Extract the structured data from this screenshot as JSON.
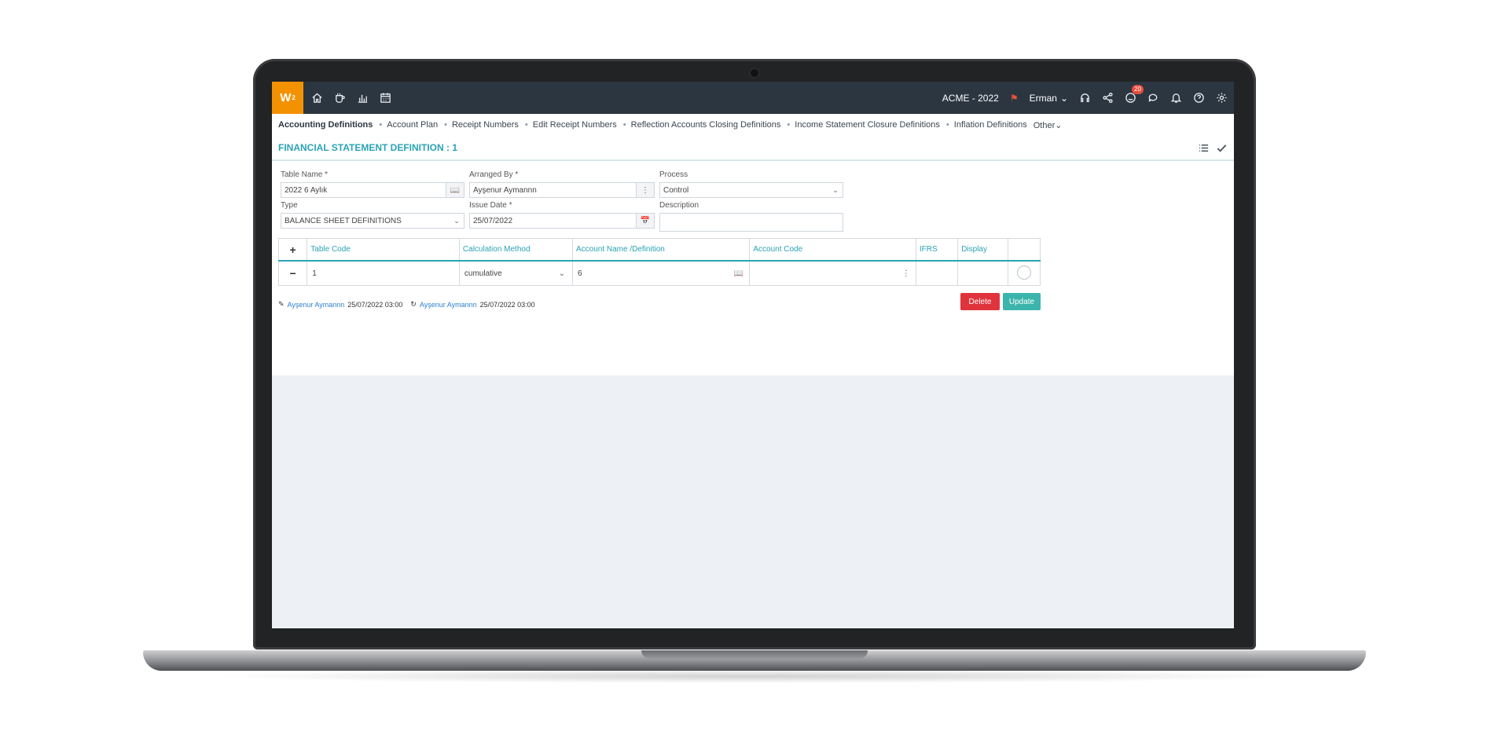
{
  "topbar": {
    "logo": "W",
    "logo_sup": "2",
    "company": "ACME - 2022",
    "user": "Erman",
    "notification_count": "20"
  },
  "menu": {
    "items": [
      "Accounting Definitions",
      "Account Plan",
      "Receipt Numbers",
      "Edit Receipt Numbers",
      "Reflection Accounts Closing Definitions",
      "Income Statement Closure Definitions",
      "Inflation Definitions",
      "Other"
    ]
  },
  "page": {
    "title": "FINANCIAL STATEMENT DEFINITION : 1"
  },
  "form": {
    "table_name_label": "Table Name *",
    "table_name_value": "2022 6 Aylık",
    "arranged_by_label": "Arranged By *",
    "arranged_by_value": "Ayşenur Aymannn",
    "process_label": "Process",
    "process_value": "Control",
    "type_label": "Type",
    "type_value": "BALANCE SHEET DEFINITIONS",
    "issue_date_label": "Issue Date *",
    "issue_date_value": "25/07/2022",
    "description_label": "Description",
    "description_value": ""
  },
  "grid": {
    "columns": [
      "Table Code",
      "Calculation Method",
      "Account Name /Definition",
      "Account Code",
      "IFRS",
      "Display"
    ],
    "rows": [
      {
        "table_code": "1",
        "calculation_method": "cumulative",
        "account_name": "6",
        "account_code": "",
        "ifrs": "",
        "display": ""
      }
    ]
  },
  "footer": {
    "created_by": "Ayşenur Aymannn",
    "created_at": "25/07/2022 03:00",
    "updated_by": "Ayşenur Aymannn",
    "updated_at": "25/07/2022 03:00"
  },
  "buttons": {
    "delete": "Delete",
    "update": "Update"
  },
  "colors": {
    "accent": "#2aa3b5",
    "topbar": "#2b3641",
    "logo": "#f39200",
    "delete": "#e0343d",
    "update": "#3bb5ab"
  }
}
